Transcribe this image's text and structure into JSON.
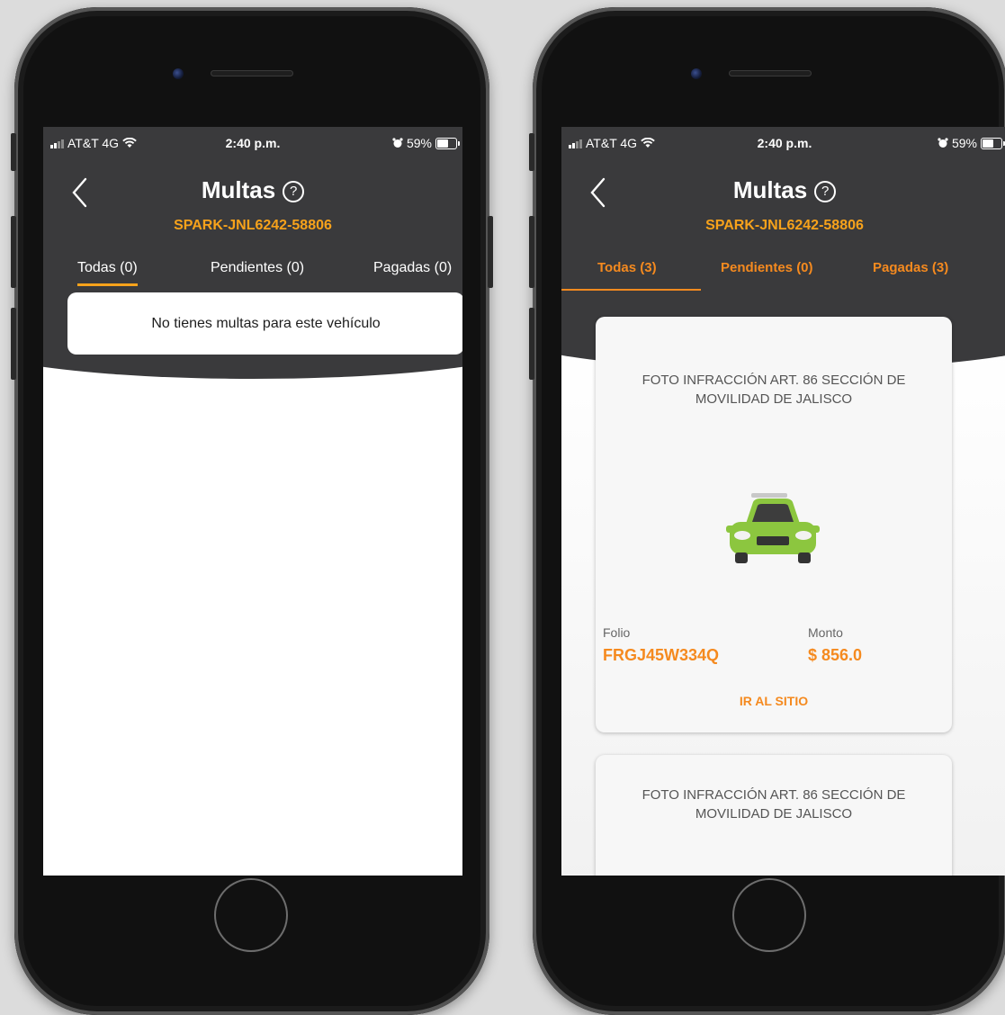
{
  "phones": [
    {
      "status": {
        "carrier": "AT&T 4G",
        "time": "2:40 p.m.",
        "battery": "59%"
      },
      "header": {
        "title": "Multas",
        "help_glyph": "?",
        "plate": "SPARK-JNL6242-58806"
      },
      "tabs": [
        {
          "label": "Todas (0)",
          "active": true
        },
        {
          "label": "Pendientes (0)",
          "active": false
        },
        {
          "label": "Pagadas (0)",
          "active": false
        }
      ],
      "empty_message": "No tienes multas para este vehículo"
    },
    {
      "status": {
        "carrier": "AT&T 4G",
        "time": "2:40 p.m.",
        "battery": "59%"
      },
      "header": {
        "title": "Multas",
        "help_glyph": "?",
        "plate": "SPARK-JNL6242-58806"
      },
      "tabs": [
        {
          "label": "Todas (3)",
          "active": true
        },
        {
          "label": "Pendientes (0)",
          "active": false
        },
        {
          "label": "Pagadas (3)",
          "active": false
        }
      ],
      "fines": [
        {
          "title": "FOTO INFRACCIÓN ART. 86 SECCIÓN DE MOVILIDAD DE JALISCO",
          "icon": "car-icon",
          "folio_label": "Folio",
          "folio": "FRGJ45W334Q",
          "monto_label": "Monto",
          "monto": "$ 856.0",
          "action": "IR AL SITIO"
        },
        {
          "title": "FOTO INFRACCIÓN ART. 86 SECCIÓN DE MOVILIDAD DE JALISCO"
        }
      ]
    }
  ],
  "colors": {
    "header": "#3a3a3c",
    "accent_yellow": "#f7a21b",
    "accent_orange": "#f58a1f",
    "car_green": "#8cc63f"
  }
}
